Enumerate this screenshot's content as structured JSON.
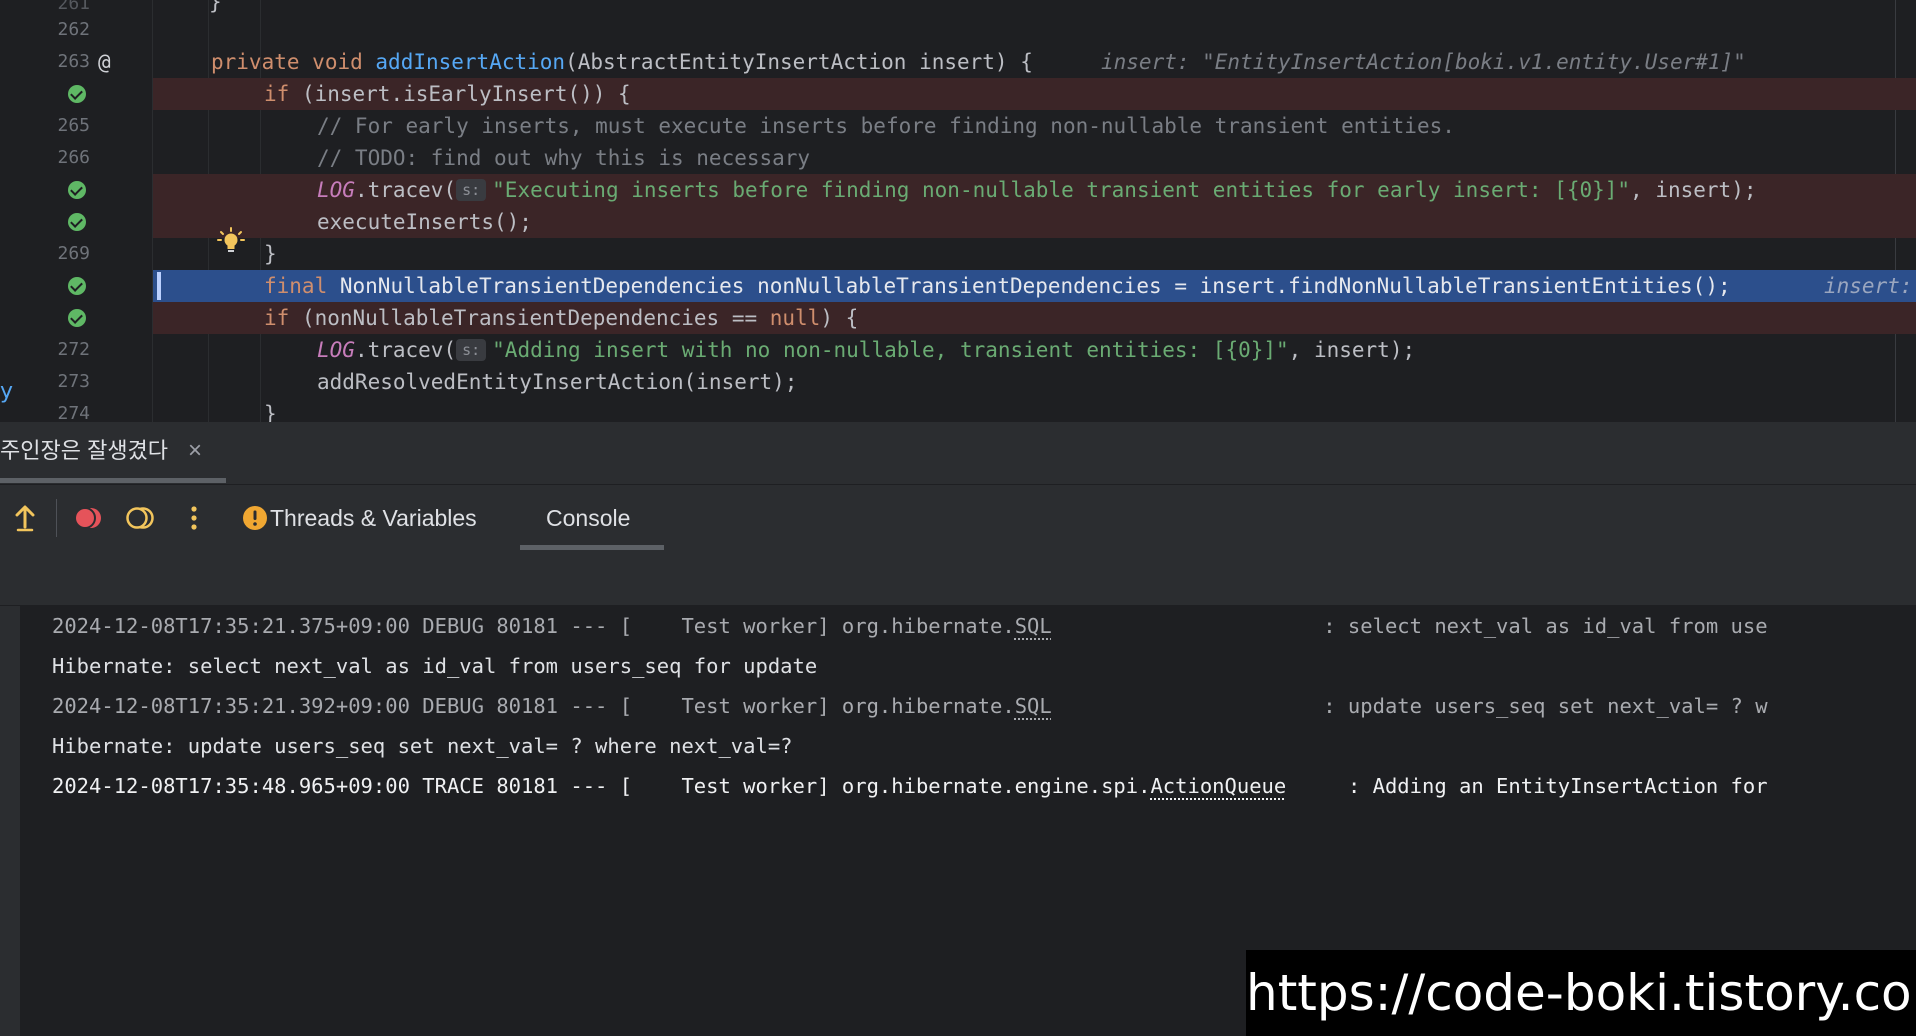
{
  "editor": {
    "gutter": {
      "line_numbers": [
        "262",
        "263",
        "265",
        "266",
        "269",
        "272",
        "273",
        "274"
      ]
    },
    "lines": [
      {
        "tokens": [
          "}"
        ]
      },
      {
        "tokens": [
          "private",
          "void",
          "addInsertAction",
          "(AbstractEntityInsertAction insert) {",
          "insert: \"EntityInsertAction[boki.v1.entity.User#1]\""
        ]
      },
      {
        "tokens": [
          "if",
          "(insert.isEarlyInsert()) {"
        ]
      },
      {
        "tokens": [
          "// For early inserts, must execute inserts before finding non-nullable transient entities."
        ]
      },
      {
        "tokens": [
          "// TODO: find out why this is necessary"
        ]
      },
      {
        "tokens": [
          "LOG",
          ".tracev(",
          "s:",
          "\"Executing inserts before finding non-nullable transient entities for early insert: [{0}]\"",
          ", insert);"
        ]
      },
      {
        "tokens": [
          "executeInserts();"
        ]
      },
      {
        "tokens": [
          "}"
        ]
      },
      {
        "tokens": [
          "final",
          "NonNullableTransientDependencies nonNullableTransientDependencies = insert.findNonNullableTransientEntities();",
          "insert:"
        ]
      },
      {
        "tokens": [
          "if",
          "(nonNullableTransientDependencies == ",
          "null",
          ") {"
        ]
      },
      {
        "tokens": [
          "LOG",
          ".tracev(",
          "s:",
          "\"Adding insert with no non-nullable, transient entities: [{0}]\"",
          ", insert);"
        ]
      },
      {
        "tokens": [
          "addResolvedEntityInsertAction(insert);"
        ]
      },
      {
        "tokens": [
          "}"
        ]
      }
    ],
    "left_edge_glyph": "y"
  },
  "debug": {
    "session_name": "주인장은 잘생겼다",
    "session_close": "×",
    "tabs": [
      {
        "label": "Threads & Variables",
        "icon": "warning-icon"
      },
      {
        "label": "Console",
        "selected": true
      }
    ]
  },
  "console": {
    "lines": [
      {
        "meta": "2024-12-08T17:35:21.375+09:00 DEBUG 80181 --- [    Test worker] org.hibernate.",
        "logger_tail": "SQL",
        "pad": "                      ",
        "message": ": select next_val as id_val from use"
      },
      {
        "text": "Hibernate: select next_val as id_val from users_seq for update"
      },
      {
        "meta": "2024-12-08T17:35:21.392+09:00 DEBUG 80181 --- [    Test worker] org.hibernate.",
        "logger_tail": "SQL",
        "pad": "                      ",
        "message": ": update users_seq set next_val= ? w"
      },
      {
        "text": "Hibernate: update users_seq set next_val= ? where next_val=?"
      },
      {
        "meta": "2024-12-08T17:35:48.965+09:00 TRACE 80181 --- [    Test worker] org.hibernate.engine.spi.",
        "logger_tail": "ActionQueue",
        "pad": "     ",
        "message": ": Adding an EntityInsertAction for"
      }
    ]
  },
  "watermark": "https://code-boki.tistory.com",
  "colors": {
    "error_line_bg": "#3b2527",
    "execution_line_bg": "#2c4f8c",
    "breakpoint_ok": "#5fb865",
    "keyword": "#cf8e6d",
    "function": "#56a8f5",
    "string": "#6aab73",
    "comment": "#7a7e85"
  }
}
